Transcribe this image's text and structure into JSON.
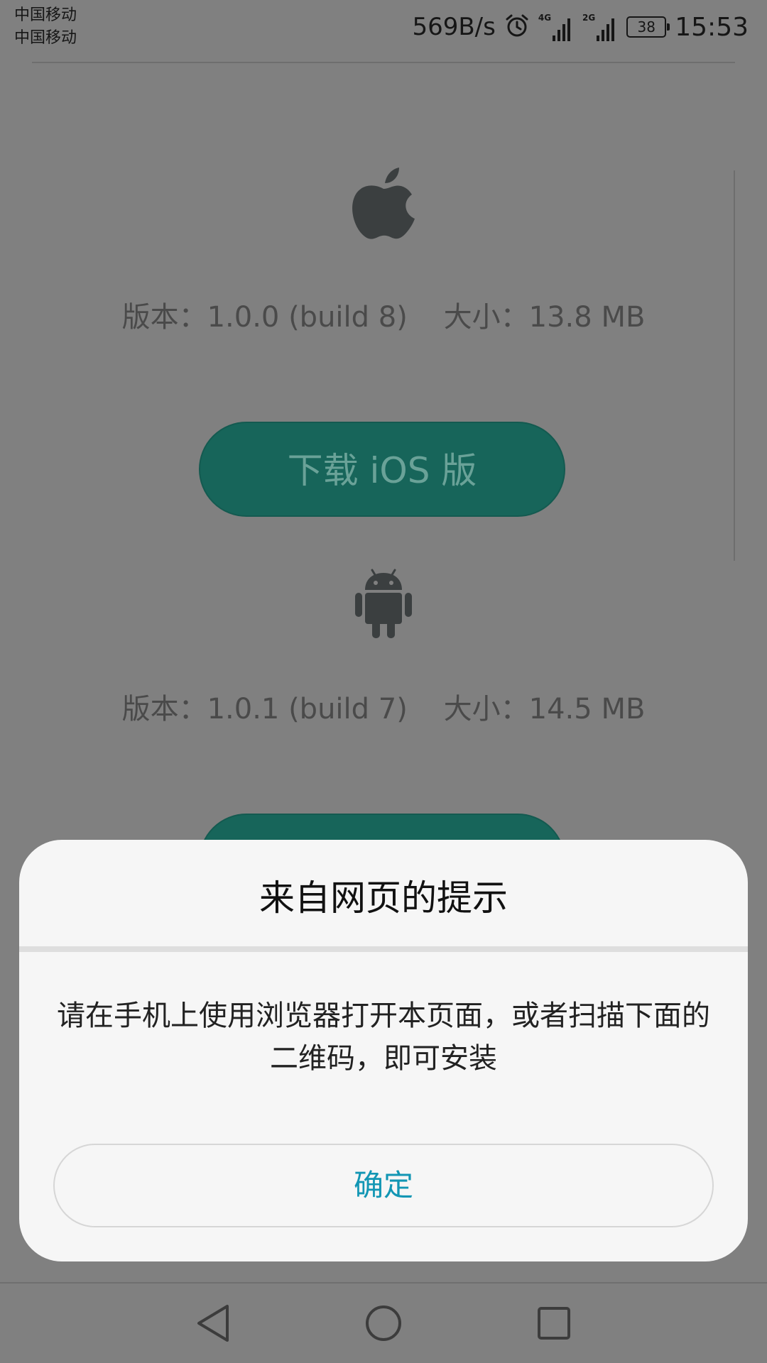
{
  "status_bar": {
    "carrier_1": "中国移动",
    "carrier_2": "中国移动",
    "net_speed": "569B/s",
    "signal_1_type": "4G",
    "signal_2_type": "2G",
    "battery_level": "38",
    "time": "15:53"
  },
  "ios": {
    "icon": "apple-icon",
    "info": "版本：1.0.0 (build 8)    大小：13.8 MB",
    "button_label": "下载 iOS 版"
  },
  "android": {
    "icon": "android-icon",
    "info": "版本：1.0.1 (build 7)    大小：14.5 MB"
  },
  "dialog": {
    "title": "来自网页的提示",
    "message": "请在手机上使用浏览器打开本页面，或者扫描下面的二维码，即可安装",
    "confirm_label": "确定"
  },
  "nav_bar": {
    "back_icon": "back-triangle-icon",
    "home_icon": "home-circle-icon",
    "recents_icon": "recents-square-icon"
  },
  "colors": {
    "accent_button": "#17655a",
    "dialog_confirm": "#1296b4",
    "overlay": "#808080"
  }
}
